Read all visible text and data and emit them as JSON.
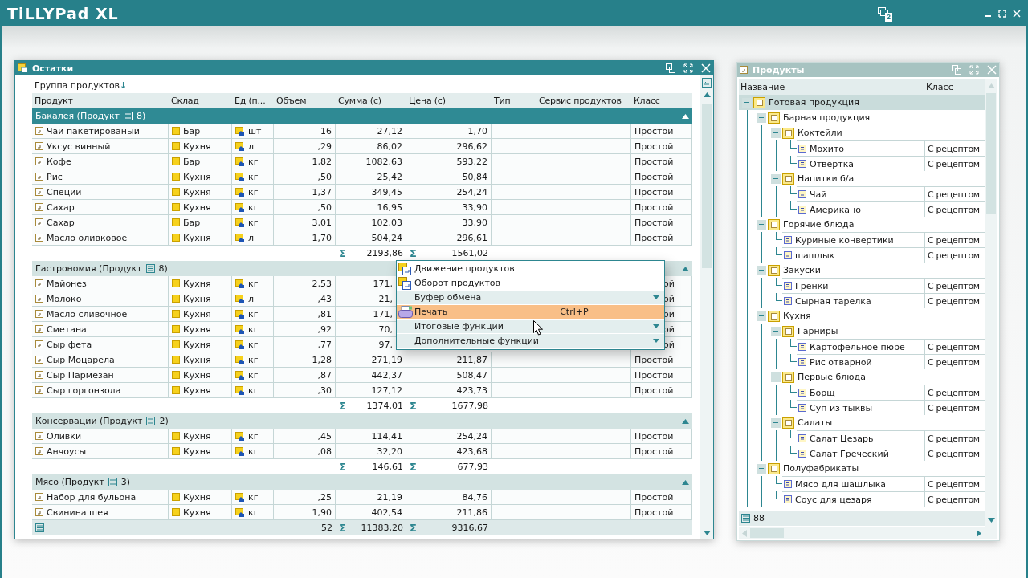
{
  "app_bar": {
    "logo": "TiLLYPad",
    "logo_suffix": "XL",
    "windows_count": "2"
  },
  "stock_window": {
    "title": "Остатки",
    "active": true,
    "group_by": "Группа продуктов",
    "sort_arrow": "↓",
    "columns": [
      "Продукт",
      "Склад",
      "Ед (п...",
      "Объем",
      "Сумма (с)",
      "Цена (с)",
      "Тип",
      "Сервис продуктов",
      "Класс"
    ],
    "groups": [
      {
        "label": "Бакалея (Продукт",
        "count": "8)",
        "selected": true,
        "rows": [
          {
            "product": "Чай пакетированый",
            "store": "Бар",
            "unit": "шт",
            "volume": "16",
            "sum": "27,12",
            "price": "1,70",
            "class": "Простой",
            "covered": false
          },
          {
            "product": "Уксус винный",
            "store": "Кухня",
            "unit": "л",
            "volume": ",29",
            "sum": "86,02",
            "price": "296,62",
            "class": "Простой",
            "covered": false
          },
          {
            "product": "Кофе",
            "store": "Бар",
            "unit": "кг",
            "volume": "1,82",
            "sum": "1082,63",
            "price": "593,22",
            "class": "Простой",
            "covered": false
          },
          {
            "product": "Рис",
            "store": "Кухня",
            "unit": "кг",
            "volume": ",50",
            "sum": "25,42",
            "price": "50,84",
            "class": "Простой",
            "covered": false
          },
          {
            "product": "Специи",
            "store": "Кухня",
            "unit": "кг",
            "volume": "1,37",
            "sum": "349,45",
            "price": "254,24",
            "class": "Простой",
            "covered": false
          },
          {
            "product": "Сахар",
            "store": "Кухня",
            "unit": "кг",
            "volume": ",50",
            "sum": "16,95",
            "price": "33,90",
            "class": "Простой",
            "covered": false
          },
          {
            "product": "Сахар",
            "store": "Бар",
            "unit": "кг",
            "volume": "3,01",
            "sum": "102,03",
            "price": "33,90",
            "class": "Простой",
            "covered": false
          },
          {
            "product": "Масло оливковое",
            "store": "Кухня",
            "unit": "л",
            "volume": "1,70",
            "sum": "504,24",
            "price": "296,61",
            "class": "Простой",
            "covered": false
          }
        ],
        "total": {
          "sum_mark": "Σ",
          "sum": "2193,86",
          "price_mark": "Σ",
          "price": "1561,02"
        }
      },
      {
        "label": "Гастрономия (Продукт",
        "count": "8)",
        "selected": false,
        "rows": [
          {
            "product": "Майонез",
            "store": "Кухня",
            "unit": "кг",
            "volume": "2,53",
            "sum": "171,",
            "class": "ой",
            "covered": true
          },
          {
            "product": "Молоко",
            "store": "Кухня",
            "unit": "л",
            "volume": ",43",
            "sum": "21,",
            "class": "ой",
            "covered": true
          },
          {
            "product": "Масло сливочное",
            "store": "Кухня",
            "unit": "кг",
            "volume": ",81",
            "sum": "171,",
            "class": "ой",
            "covered": true
          },
          {
            "product": "Сметана",
            "store": "Кухня",
            "unit": "кг",
            "volume": ",92",
            "sum": "70,",
            "class": "ой",
            "covered": true
          },
          {
            "product": "Сыр фета",
            "store": "Кухня",
            "unit": "кг",
            "volume": ",77",
            "sum": "97,",
            "class": "ой",
            "covered": true
          },
          {
            "product": "Сыр Моцарела",
            "store": "Кухня",
            "unit": "кг",
            "volume": "1,28",
            "sum": "271,19",
            "price": "211,87",
            "class": "Простой",
            "covered": false
          },
          {
            "product": "Сыр Пармезан",
            "store": "Кухня",
            "unit": "кг",
            "volume": ",87",
            "sum": "442,37",
            "price": "508,47",
            "class": "Простой",
            "covered": false
          },
          {
            "product": "Сыр горгонзола",
            "store": "Кухня",
            "unit": "кг",
            "volume": ",30",
            "sum": "127,12",
            "price": "423,73",
            "class": "Простой",
            "covered": false
          }
        ],
        "total": {
          "sum_mark": "Σ",
          "sum": "1374,01",
          "price_mark": "Σ",
          "price": "1677,98"
        }
      },
      {
        "label": "Консервации (Продукт",
        "count": "2)",
        "selected": false,
        "rows": [
          {
            "product": "Оливки",
            "store": "Кухня",
            "unit": "кг",
            "volume": ",45",
            "sum": "114,41",
            "price": "254,24",
            "class": "Простой",
            "covered": false
          },
          {
            "product": "Анчоусы",
            "store": "Кухня",
            "unit": "кг",
            "volume": ",08",
            "sum": "32,20",
            "price": "423,68",
            "class": "Простой",
            "covered": false
          }
        ],
        "total": {
          "sum_mark": "Σ",
          "sum": "146,61",
          "price_mark": "Σ",
          "price": "677,93"
        }
      },
      {
        "label": "Мясо (Продукт",
        "count": "3)",
        "selected": false,
        "rows": [
          {
            "product": "Набор для бульона",
            "store": "Кухня",
            "unit": "кг",
            "volume": ",25",
            "sum": "21,19",
            "price": "84,76",
            "class": "Простой",
            "covered": false
          },
          {
            "product": "Свинина шея",
            "store": "Кухня",
            "unit": "кг",
            "volume": "1,90",
            "sum": "402,54",
            "price": "211,86",
            "class": "Простой",
            "covered": false
          }
        ]
      }
    ],
    "footer": {
      "count": "52",
      "sum_mark": "Σ",
      "sum": "11383,20",
      "price_mark": "Σ",
      "price": "9316,67"
    }
  },
  "context_menu": {
    "items": [
      {
        "label": "Движение продуктов",
        "kind": "report",
        "selected": false
      },
      {
        "label": "Оборот продуктов",
        "kind": "report",
        "selected": false
      },
      {
        "label": "Буфер обмена",
        "kind": "submenu",
        "selected": false
      },
      {
        "label": "Печать",
        "kind": "print",
        "shortcut": "Ctrl+P",
        "selected": true
      },
      {
        "label": "Итоговые функции",
        "kind": "submenu",
        "selected": false
      },
      {
        "label": "Дополнительные функции",
        "kind": "submenu",
        "selected": false
      }
    ]
  },
  "products_window": {
    "title": "Продукты",
    "active": false,
    "columns": [
      "Название",
      "Класс"
    ],
    "tree": [
      {
        "label": "Готовая продукция",
        "kind": "folder",
        "expanded": true,
        "selected": true,
        "children": [
          {
            "label": "Барная продукция",
            "kind": "folder",
            "expanded": true,
            "selected": false,
            "children": [
              {
                "label": "Коктейли",
                "kind": "folder",
                "expanded": true,
                "selected": false,
                "children": [
                  {
                    "label": "Мохито",
                    "kind": "item",
                    "class": "С рецептом",
                    "selected": false
                  },
                  {
                    "label": "Отвертка",
                    "kind": "item",
                    "class": "С рецептом",
                    "selected": false
                  }
                ]
              },
              {
                "label": "Напитки б/а",
                "kind": "folder",
                "expanded": true,
                "selected": false,
                "children": [
                  {
                    "label": "Чай",
                    "kind": "item",
                    "class": "С рецептом",
                    "selected": false
                  },
                  {
                    "label": "Американо",
                    "kind": "item",
                    "class": "С рецептом",
                    "selected": false
                  }
                ]
              }
            ]
          },
          {
            "label": "Горячие блюда",
            "kind": "folder",
            "expanded": true,
            "selected": false,
            "children": [
              {
                "label": "Куриные конвертики",
                "kind": "item",
                "class": "С рецептом",
                "selected": false
              },
              {
                "label": "шашлык",
                "kind": "item",
                "class": "С рецептом",
                "selected": false
              }
            ]
          },
          {
            "label": "Закуски",
            "kind": "folder",
            "expanded": true,
            "selected": false,
            "children": [
              {
                "label": "Гренки",
                "kind": "item",
                "class": "С рецептом",
                "selected": false
              },
              {
                "label": "Сырная тарелка",
                "kind": "item",
                "class": "С рецептом",
                "selected": false
              }
            ]
          },
          {
            "label": "Кухня",
            "kind": "folder",
            "expanded": true,
            "selected": false,
            "children": [
              {
                "label": "Гарниры",
                "kind": "folder",
                "expanded": true,
                "selected": false,
                "children": [
                  {
                    "label": "Картофельное пюре",
                    "kind": "item",
                    "class": "С рецептом",
                    "selected": false
                  },
                  {
                    "label": "Рис отварной",
                    "kind": "item",
                    "class": "С рецептом",
                    "selected": false
                  }
                ]
              },
              {
                "label": "Первые блюда",
                "kind": "folder",
                "expanded": true,
                "selected": false,
                "children": [
                  {
                    "label": "Борщ",
                    "kind": "item",
                    "class": "С рецептом",
                    "selected": false
                  },
                  {
                    "label": "Суп из тыквы",
                    "kind": "item",
                    "class": "С рецептом",
                    "selected": false
                  }
                ]
              },
              {
                "label": "Салаты",
                "kind": "folder",
                "expanded": true,
                "selected": false,
                "children": [
                  {
                    "label": "Салат Цезарь",
                    "kind": "item",
                    "class": "С рецептом",
                    "selected": false
                  },
                  {
                    "label": "Салат Греческий",
                    "kind": "item",
                    "class": "С рецептом",
                    "selected": false
                  }
                ]
              }
            ]
          },
          {
            "label": "Полуфабрикаты",
            "kind": "folder",
            "expanded": true,
            "selected": false,
            "children": [
              {
                "label": "Мясо для шашлыка",
                "kind": "item",
                "class": "С рецептом",
                "selected": false
              },
              {
                "label": "Соус для цезаря",
                "kind": "item",
                "class": "С рецептом",
                "selected": false
              }
            ]
          }
        ]
      }
    ],
    "footer_count": "88"
  }
}
